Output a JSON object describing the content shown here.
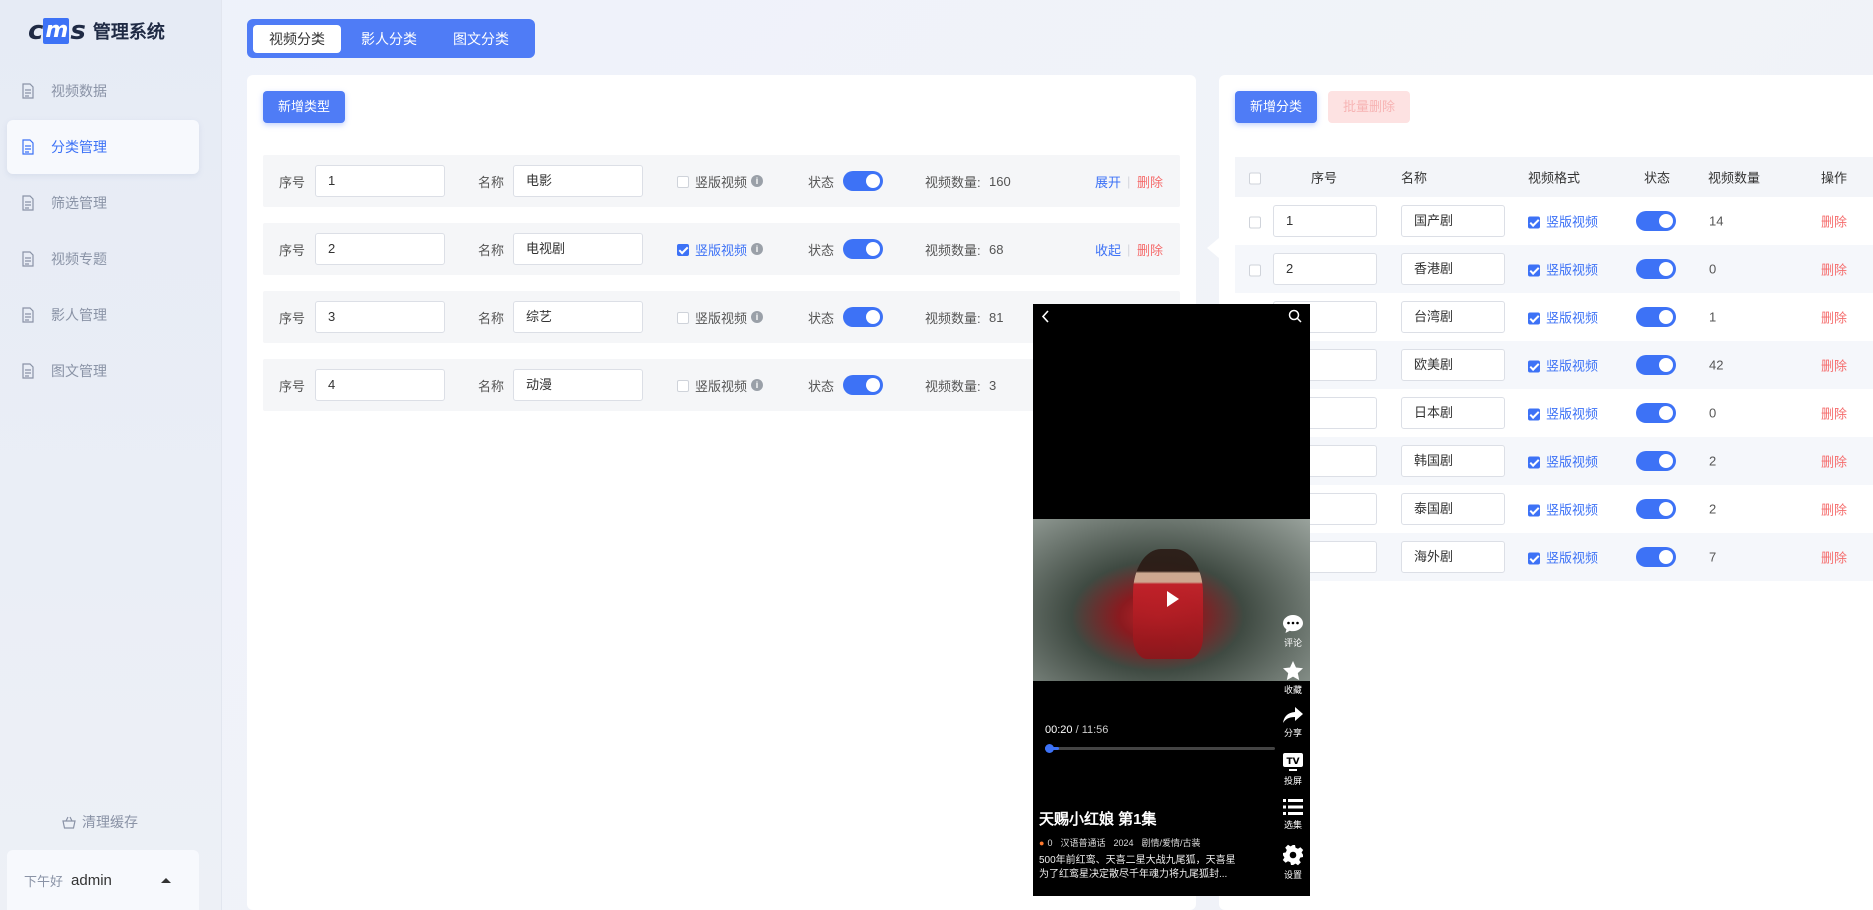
{
  "app": {
    "logo_text": "cms",
    "title": "管理系统"
  },
  "sidebar": {
    "items": [
      {
        "label": "视频数据",
        "icon": "document-icon",
        "active": false
      },
      {
        "label": "分类管理",
        "icon": "document-icon",
        "active": true
      },
      {
        "label": "筛选管理",
        "icon": "document-icon",
        "active": false
      },
      {
        "label": "视频专题",
        "icon": "document-icon",
        "active": false
      },
      {
        "label": "影人管理",
        "icon": "document-icon",
        "active": false
      },
      {
        "label": "图文管理",
        "icon": "document-icon",
        "active": false
      }
    ],
    "clear_cache": "清理缓存",
    "greeting": "下午好",
    "username": "admin"
  },
  "tabs": [
    {
      "label": "视频分类",
      "active": true
    },
    {
      "label": "影人分类",
      "active": false
    },
    {
      "label": "图文分类",
      "active": false
    }
  ],
  "left_panel": {
    "add_type_button": "新增类型",
    "labels": {
      "seq": "序号",
      "name": "名称",
      "vertical": "竖版视频",
      "status": "状态",
      "video_count": "视频数量:"
    },
    "rows": [
      {
        "seq": "1",
        "name": "电影",
        "vertical": false,
        "status": true,
        "count": "160",
        "toggle": "展开",
        "delete": "删除"
      },
      {
        "seq": "2",
        "name": "电视剧",
        "vertical": true,
        "status": true,
        "count": "68",
        "toggle": "收起",
        "delete": "删除"
      },
      {
        "seq": "3",
        "name": "综艺",
        "vertical": false,
        "status": true,
        "count": "81",
        "toggle": "",
        "delete": ""
      },
      {
        "seq": "4",
        "name": "动漫",
        "vertical": false,
        "status": true,
        "count": "3",
        "toggle": "",
        "delete": ""
      }
    ]
  },
  "right_panel": {
    "add_button": "新增分类",
    "batch_delete_button": "批量删除",
    "columns": [
      "序号",
      "名称",
      "视频格式",
      "状态",
      "视频数量",
      "操作"
    ],
    "rows": [
      {
        "seq": "1",
        "name": "国产剧",
        "format": "竖版视频",
        "count": "14",
        "action": "删除"
      },
      {
        "seq": "2",
        "name": "香港剧",
        "format": "竖版视频",
        "count": "0",
        "action": "删除"
      },
      {
        "seq": "",
        "name": "台湾剧",
        "format": "竖版视频",
        "count": "1",
        "action": "删除"
      },
      {
        "seq": "",
        "name": "欧美剧",
        "format": "竖版视频",
        "count": "42",
        "action": "删除"
      },
      {
        "seq": "",
        "name": "日本剧",
        "format": "竖版视频",
        "count": "0",
        "action": "删除"
      },
      {
        "seq": "",
        "name": "韩国剧",
        "format": "竖版视频",
        "count": "2",
        "action": "删除"
      },
      {
        "seq": "",
        "name": "泰国剧",
        "format": "竖版视频",
        "count": "2",
        "action": "删除"
      },
      {
        "seq": "",
        "name": "海外剧",
        "format": "竖版视频",
        "count": "7",
        "action": "删除"
      }
    ]
  },
  "phone_preview": {
    "current_time": "00:20",
    "total_time": "/ 11:56",
    "progress_fraction": 0.028,
    "actions": [
      "评论",
      "收藏",
      "分享",
      "投屏",
      "选集",
      "设置"
    ],
    "title": "天赐小红娘 第1集",
    "heat": "0",
    "meta": [
      "汉语普通话",
      "2024",
      "剧情/爱情/古装"
    ],
    "description": "500年前红鸾、天喜二星大战九尾狐，天喜星为了红鸾星决定散尽千年魂力将九尾狐封..."
  },
  "colors": {
    "accent": "#3d72f6",
    "danger": "#f56c6c",
    "tab_bar": "#4f7cf6"
  }
}
